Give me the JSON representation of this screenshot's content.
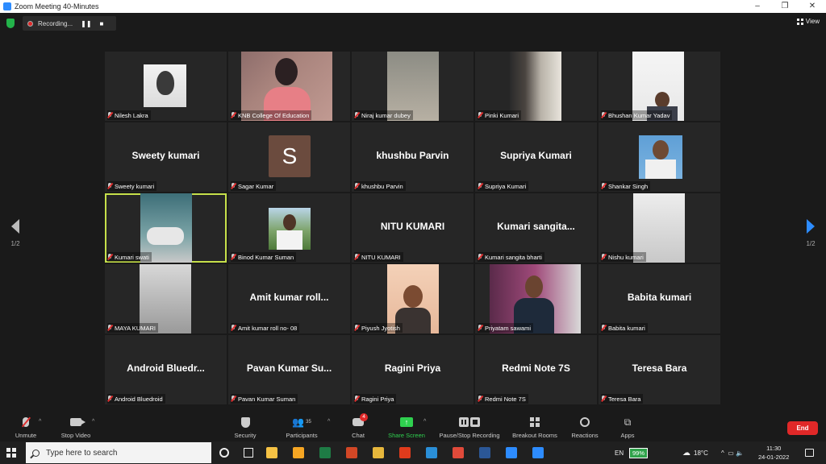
{
  "window": {
    "title": "Zoom Meeting 40-Minutes",
    "controls": [
      "–",
      "❐",
      "✕"
    ]
  },
  "topbar": {
    "recording_label": "Recording...",
    "pause_glyph": "❚❚",
    "stop_glyph": "■",
    "view_label": "View"
  },
  "pagination": {
    "left": "1/2",
    "right": "1/2"
  },
  "participants": [
    {
      "name": "Nilesh Lakra",
      "display": "",
      "video": "nilesh"
    },
    {
      "name": "KNB College Of Education",
      "display": "",
      "video": "knb"
    },
    {
      "name": "Niraj kumar dubey",
      "display": "",
      "video": "niraj"
    },
    {
      "name": "Pinki Kumari",
      "display": "",
      "video": "pinki"
    },
    {
      "name": "Bhushan Kumar Yadav",
      "display": "",
      "video": "bhushan"
    },
    {
      "name": "Sweety kumari",
      "display": "Sweety kumari",
      "video": ""
    },
    {
      "name": "Sagar Kumar",
      "display": "",
      "video": "sagar",
      "initial": "S"
    },
    {
      "name": "khushbu Parvin",
      "display": "khushbu Parvin",
      "video": ""
    },
    {
      "name": "Supriya Kumari",
      "display": "Supriya Kumari",
      "video": ""
    },
    {
      "name": "Shankar Singh",
      "display": "",
      "video": "shankar"
    },
    {
      "name": "Kumari swati",
      "display": "",
      "video": "swati",
      "active": true
    },
    {
      "name": "Binod Kumar Suman",
      "display": "",
      "video": "binod"
    },
    {
      "name": "NITU KUMARI",
      "display": "NITU KUMARI",
      "video": ""
    },
    {
      "name": "Kumari sangita bharti",
      "display": "Kumari sangita...",
      "video": ""
    },
    {
      "name": "Nishu kumari",
      "display": "",
      "video": "nishu"
    },
    {
      "name": "MAYA KUMARI",
      "display": "",
      "video": "maya"
    },
    {
      "name": "Amit kumar roll no- 08",
      "display": "Amit kumar roll...",
      "video": ""
    },
    {
      "name": "Piyush Jyotish",
      "display": "",
      "video": "piyush"
    },
    {
      "name": "Priyatam sawami",
      "display": "",
      "video": "priyatam"
    },
    {
      "name": "Babita kumari",
      "display": "Babita kumari",
      "video": ""
    },
    {
      "name": "Android Bluedroid",
      "display": "Android Bluedr...",
      "video": ""
    },
    {
      "name": "Pavan Kumar Suman",
      "display": "Pavan Kumar Su...",
      "video": ""
    },
    {
      "name": "Ragini  Priya",
      "display": "Ragini  Priya",
      "video": ""
    },
    {
      "name": "Redmi Note 7S",
      "display": "Redmi Note 7S",
      "video": ""
    },
    {
      "name": "Teresa Bara",
      "display": "Teresa Bara",
      "video": ""
    }
  ],
  "toolbar": {
    "unmute": "Unmute",
    "stop_video": "Stop Video",
    "security": "Security",
    "participants": "Participants",
    "participants_count": "35",
    "chat": "Chat",
    "chat_badge": "4",
    "share_screen": "Share Screen",
    "pause_stop_recording": "Pause/Stop Recording",
    "breakout_rooms": "Breakout Rooms",
    "reactions": "Reactions",
    "apps": "Apps",
    "end": "End",
    "caret": "^"
  },
  "taskbar": {
    "search_placeholder": "Type here to search",
    "lang": "EN",
    "battery": "99%",
    "weather": "18°C",
    "time": "11:30",
    "date": "24-01-2022",
    "apps": [
      {
        "name": "file-explorer-app",
        "color": "#f6c244"
      },
      {
        "name": "store-app",
        "color": "#f6a623"
      },
      {
        "name": "excel-app",
        "color": "#1e7b45"
      },
      {
        "name": "powerpoint-app",
        "color": "#d24726"
      },
      {
        "name": "folder-app",
        "color": "#e7b73c"
      },
      {
        "name": "office-app",
        "color": "#e03b1c"
      },
      {
        "name": "edge-app",
        "color": "#2a8fd8"
      },
      {
        "name": "chrome-app",
        "color": "#e04a3a"
      },
      {
        "name": "word-app",
        "color": "#2b5797"
      },
      {
        "name": "zoom-app",
        "color": "#2d8cff"
      },
      {
        "name": "zoom-meeting-app",
        "color": "#2d8cff"
      }
    ]
  }
}
